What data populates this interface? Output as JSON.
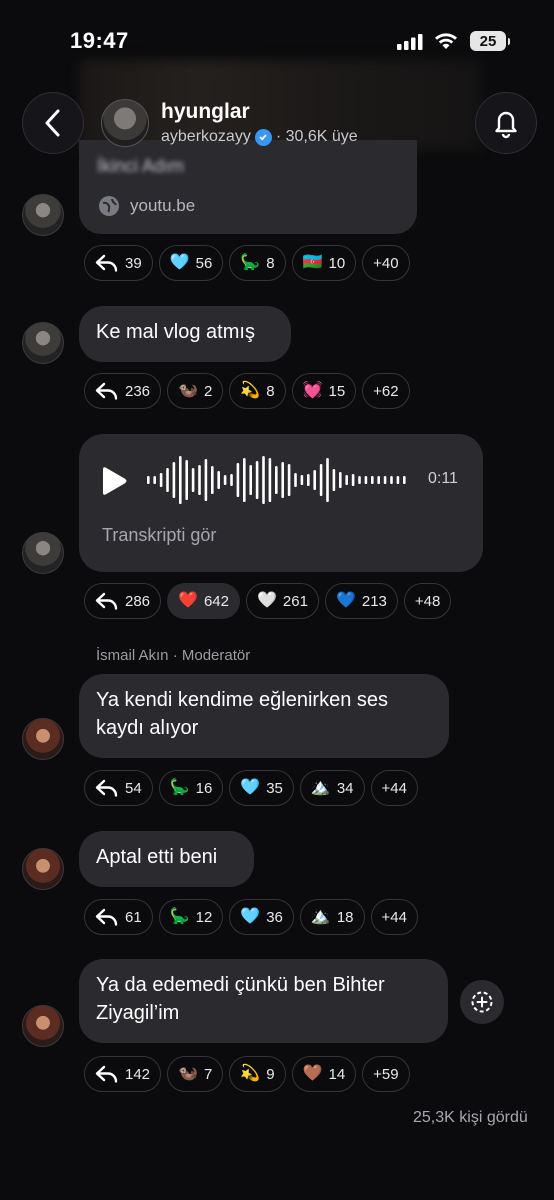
{
  "status_bar": {
    "time": "19:47",
    "battery": "25"
  },
  "channel": {
    "name": "hyunglar",
    "owner": "ayberkozayy",
    "members": "· 30,6K üye"
  },
  "link_preview": {
    "title": "İkinci Adım",
    "domain": "youtu.be"
  },
  "messages": [
    {
      "id": "m1",
      "reactions": [
        {
          "type": "reply",
          "count": "39"
        },
        {
          "emoji": "🩵",
          "count": "56"
        },
        {
          "emoji": "🦕",
          "count": "8"
        },
        {
          "emoji": "🇦🇿",
          "count": "10"
        },
        {
          "more": "+40"
        }
      ]
    },
    {
      "id": "m2",
      "text": "Ke mal vlog atmış",
      "reactions": [
        {
          "type": "reply",
          "count": "236"
        },
        {
          "emoji": "🦦",
          "count": "2"
        },
        {
          "emoji": "💫",
          "count": "8"
        },
        {
          "emoji": "💓",
          "count": "15"
        },
        {
          "more": "+62"
        }
      ]
    },
    {
      "id": "m3",
      "voice": {
        "duration": "0:11",
        "transcript_label": "Transkripti gör"
      },
      "reactions": [
        {
          "type": "reply",
          "count": "286"
        },
        {
          "emoji": "❤️",
          "count": "642",
          "selected": true
        },
        {
          "emoji": "🤍",
          "count": "261"
        },
        {
          "emoji": "💙",
          "count": "213"
        },
        {
          "more": "+48"
        }
      ]
    },
    {
      "id": "m4",
      "sender": "İsmail Akın · Moderatör",
      "text": "Ya kendi kendime eğlenirken ses kaydı alıyor",
      "reactions": [
        {
          "type": "reply",
          "count": "54"
        },
        {
          "emoji": "🦕",
          "count": "16"
        },
        {
          "emoji": "🩵",
          "count": "35"
        },
        {
          "emoji": "🏔️",
          "count": "34"
        },
        {
          "more": "+44"
        }
      ]
    },
    {
      "id": "m5",
      "text": "Aptal etti beni",
      "reactions": [
        {
          "type": "reply",
          "count": "61"
        },
        {
          "emoji": "🦕",
          "count": "12"
        },
        {
          "emoji": "🩵",
          "count": "36"
        },
        {
          "emoji": "🏔️",
          "count": "18"
        },
        {
          "more": "+44"
        }
      ]
    },
    {
      "id": "m6",
      "text": "Ya da edemedi çünkü ben Bihter Ziyagil’im",
      "reactions": [
        {
          "type": "reply",
          "count": "142"
        },
        {
          "emoji": "🦦",
          "count": "7"
        },
        {
          "emoji": "💫",
          "count": "9"
        },
        {
          "emoji": "🤎",
          "count": "14"
        },
        {
          "more": "+59"
        }
      ]
    }
  ],
  "seen_by": "25,3K kişi gördü",
  "colors": {
    "background": "#0b0b0d",
    "bubble": "#2a2a2f",
    "verified": "#3897f0"
  },
  "icons": [
    "back-chevron-icon",
    "bell-icon",
    "globe-icon",
    "play-icon",
    "reply-arrow-icon",
    "add-reaction-icon"
  ]
}
